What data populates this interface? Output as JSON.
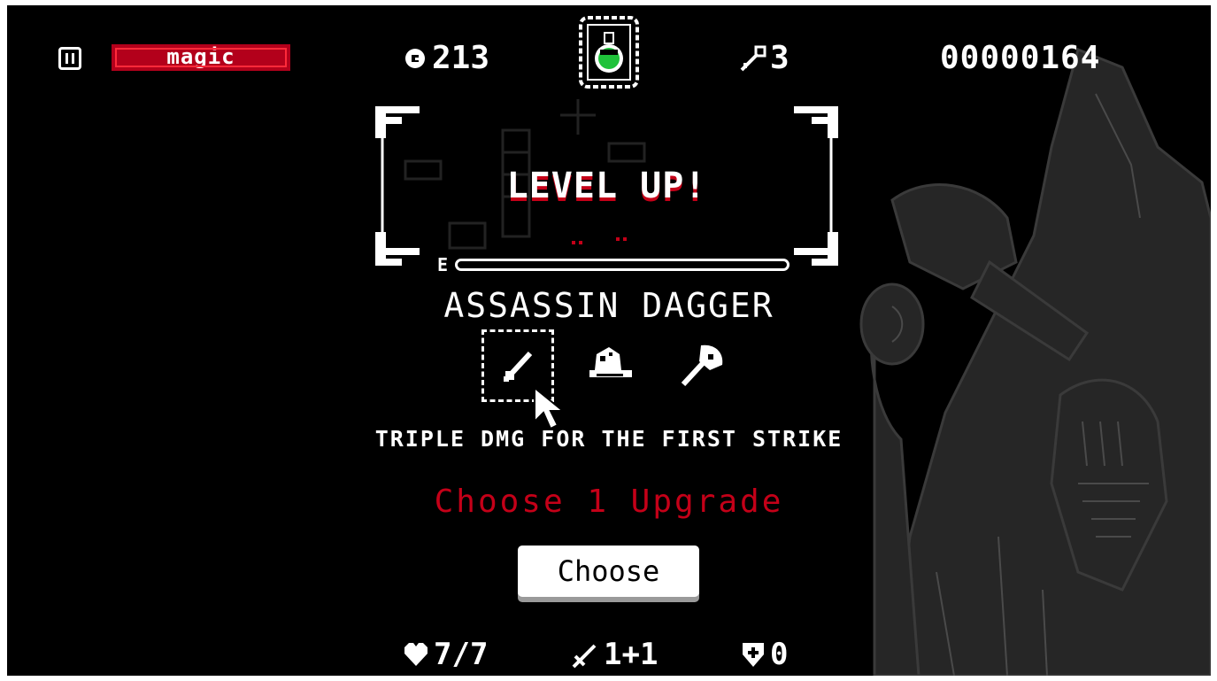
{
  "hud": {
    "mode_label": "magic",
    "coins": "213",
    "keys": "3",
    "score": "00000164"
  },
  "level_up": {
    "title": "LEVEL UP!",
    "xp_label": "E",
    "xp_progress": 1.0
  },
  "upgrade": {
    "name": "ASSASSIN DAGGER",
    "description": "TRIPLE DMG FOR THE FIRST STRIKE",
    "options": [
      {
        "icon": "dagger-icon",
        "selected": true
      },
      {
        "icon": "wizard-hat-icon",
        "selected": false
      },
      {
        "icon": "axe-icon",
        "selected": false
      }
    ],
    "hint": "Choose 1 Upgrade",
    "button_label": "Choose"
  },
  "stats": {
    "health": "7/7",
    "attack": "1+1",
    "defense": "0"
  },
  "colors": {
    "background": "#000000",
    "accent_red": "#c40018",
    "potion_green": "#1fc23a",
    "foreground": "#ffffff"
  }
}
